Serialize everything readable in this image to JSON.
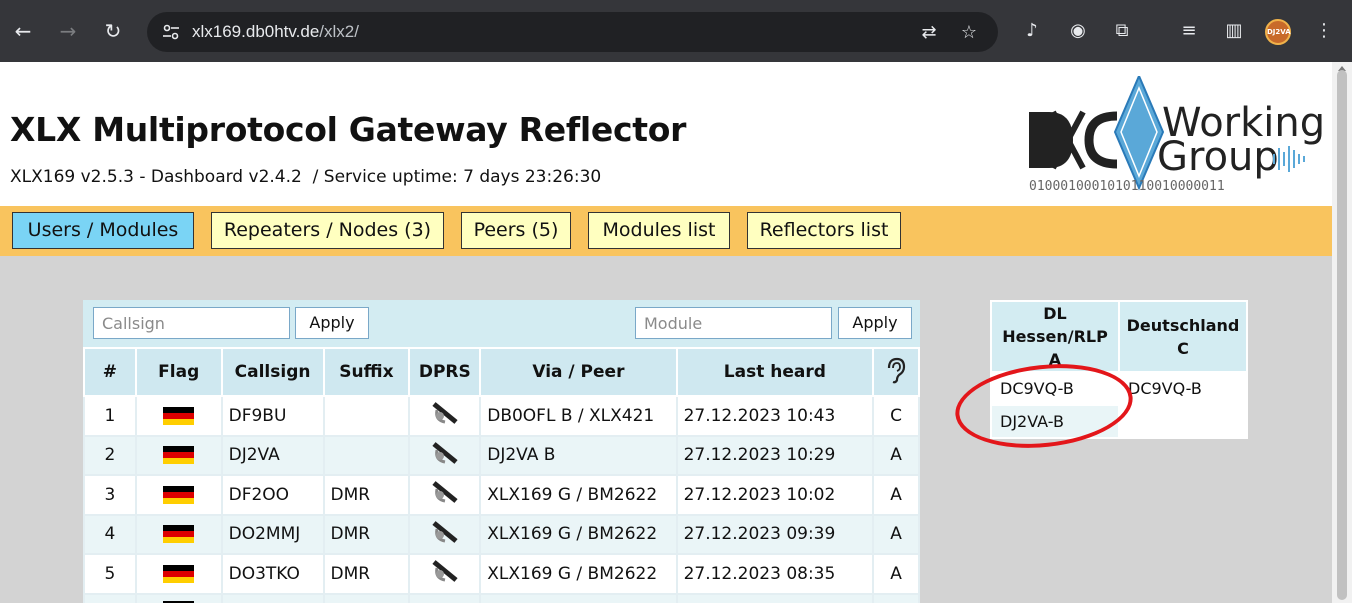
{
  "browser": {
    "url_host": "xlx169.db0htv.de",
    "url_path": "/xlx2/",
    "profile_badge": "DJ2VA"
  },
  "header": {
    "title": "XLX Multiprotocol Gateway Reflector",
    "version": "XLX169 v2.5.3 - Dashboard v2.4.2",
    "uptime": "/  Service uptime: 7 days 23:26:30",
    "logo_word1": "Working",
    "logo_word2": "Group",
    "logo_binary": "0100010001010110010000011"
  },
  "menu": {
    "items": [
      {
        "label": "Users / Modules",
        "active": true
      },
      {
        "label": "Repeaters / Nodes (3)"
      },
      {
        "label": "Peers (5)"
      },
      {
        "label": "Modules list"
      },
      {
        "label": "Reflectors list"
      }
    ]
  },
  "filters": {
    "callsign_placeholder": "Callsign",
    "module_placeholder": "Module",
    "apply_label": "Apply"
  },
  "users_table": {
    "headers": [
      "#",
      "Flag",
      "Callsign",
      "Suffix",
      "DPRS",
      "Via / Peer",
      "Last heard"
    ],
    "rows": [
      {
        "num": "1",
        "callsign": "DF9BU",
        "suffix": "",
        "via": "DB0OFL B / XLX421",
        "last_heard": "27.12.2023 10:43",
        "module": "C"
      },
      {
        "num": "2",
        "callsign": "DJ2VA",
        "suffix": "",
        "via": "DJ2VA B",
        "last_heard": "27.12.2023 10:29",
        "module": "A"
      },
      {
        "num": "3",
        "callsign": "DF2OO",
        "suffix": "DMR",
        "via": "XLX169 G / BM2622",
        "last_heard": "27.12.2023 10:02",
        "module": "A"
      },
      {
        "num": "4",
        "callsign": "DO2MMJ",
        "suffix": "DMR",
        "via": "XLX169 G / BM2622",
        "last_heard": "27.12.2023 09:39",
        "module": "A"
      },
      {
        "num": "5",
        "callsign": "DO3TKO",
        "suffix": "DMR",
        "via": "XLX169 G / BM2622",
        "last_heard": "27.12.2023 08:35",
        "module": "A"
      }
    ]
  },
  "modules": {
    "col1_name": "DL Hessen/RLP",
    "col1_letter": "A",
    "col2_name": "Deutschland",
    "col2_letter": "C",
    "col1_nodes": [
      "DC9VQ-B",
      "DJ2VA-B"
    ],
    "col2_nodes": [
      "DC9VQ-B"
    ]
  },
  "colors": {
    "menu_bar": "#f9c45e",
    "menu_active": "#7ad4f5",
    "menu_button": "#ffffc0",
    "annotation": "#e3161a"
  }
}
